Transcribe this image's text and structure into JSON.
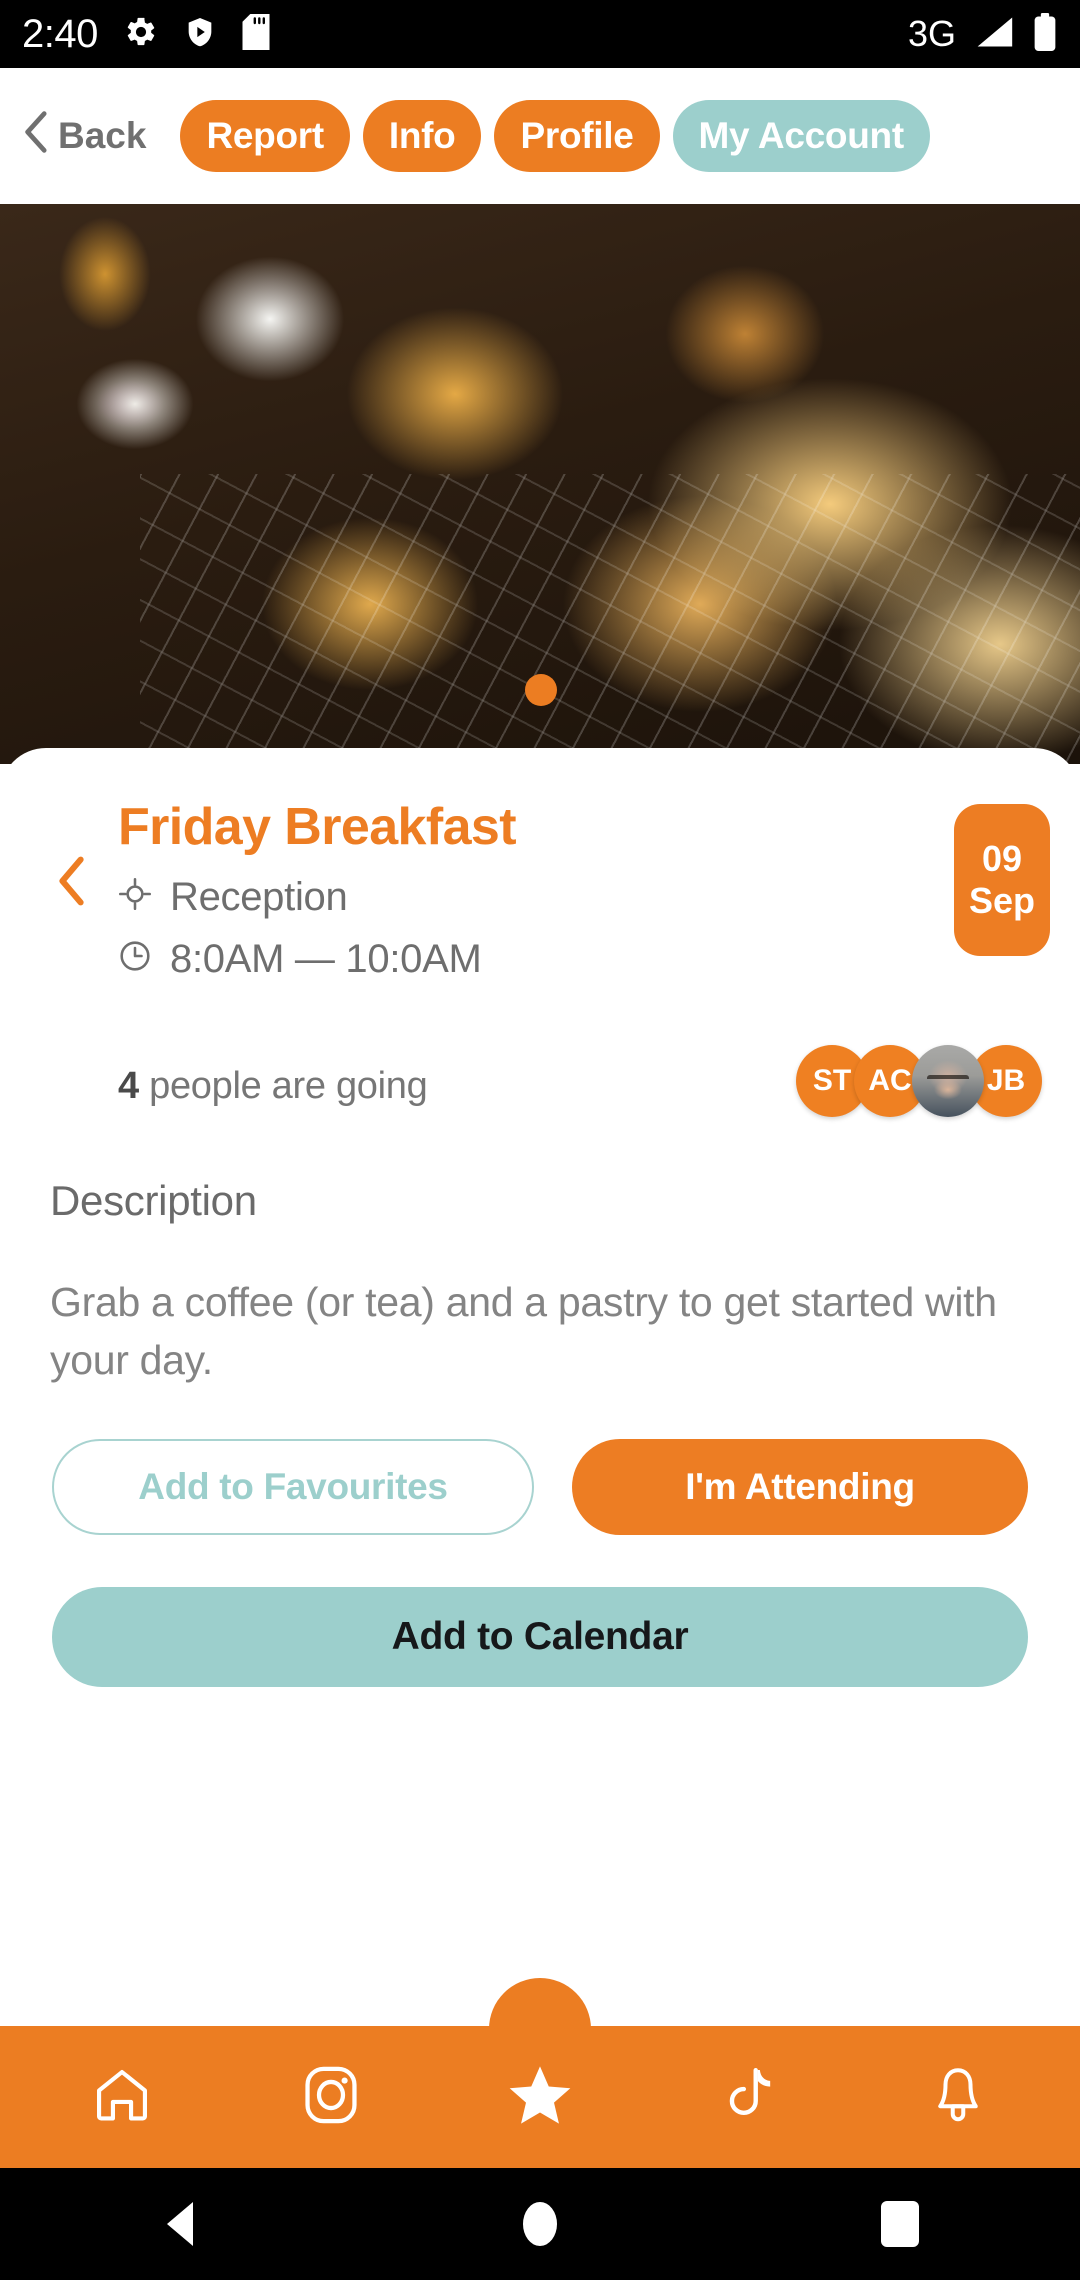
{
  "status_bar": {
    "time": "2:40",
    "network": "3G",
    "icons": [
      "gear-icon",
      "play-protect-shield-icon",
      "sd-card-icon",
      "signal-icon",
      "battery-icon"
    ]
  },
  "top_nav": {
    "back_label": "Back",
    "chips": [
      {
        "label": "Report",
        "style": "orange"
      },
      {
        "label": "Info",
        "style": "orange"
      },
      {
        "label": "Profile",
        "style": "orange"
      },
      {
        "label": "My Account",
        "style": "teal"
      }
    ]
  },
  "hero": {
    "alt": "pastries-croissants-coffee-photo",
    "carousel_active_index": 0,
    "carousel_count": 1
  },
  "event": {
    "title": "Friday Breakfast",
    "location": "Reception",
    "time": "8:0AM — 10:0AM",
    "date_day": "09",
    "date_month": "Sep",
    "attendees_count": "4",
    "attendees_suffix": "people are going",
    "avatars": [
      {
        "initials": "ST",
        "type": "initials"
      },
      {
        "initials": "AC",
        "type": "initials"
      },
      {
        "initials": "",
        "type": "photo"
      },
      {
        "initials": "JB",
        "type": "initials"
      }
    ]
  },
  "description": {
    "heading": "Description",
    "body": "Grab a coffee (or tea) and a pastry to get started with your day."
  },
  "actions": {
    "favourites": "Add to Favourites",
    "attending": "I'm Attending",
    "calendar": "Add to Calendar"
  },
  "bottom_nav": {
    "items": [
      {
        "name": "home-icon",
        "label": "Home"
      },
      {
        "name": "instagram-icon",
        "label": "Instagram"
      },
      {
        "name": "star-icon",
        "label": "Favourites"
      },
      {
        "name": "tiktok-icon",
        "label": "TikTok"
      },
      {
        "name": "bell-icon",
        "label": "Notifications"
      }
    ],
    "active_index": 2
  },
  "system_bar": {
    "items": [
      "back-button",
      "home-button",
      "recents-button"
    ]
  },
  "colors": {
    "orange": "#EC7D22",
    "teal": "#9CCFCC",
    "title_orange": "#ED7D23",
    "grey_text": "#6e6e6e"
  }
}
